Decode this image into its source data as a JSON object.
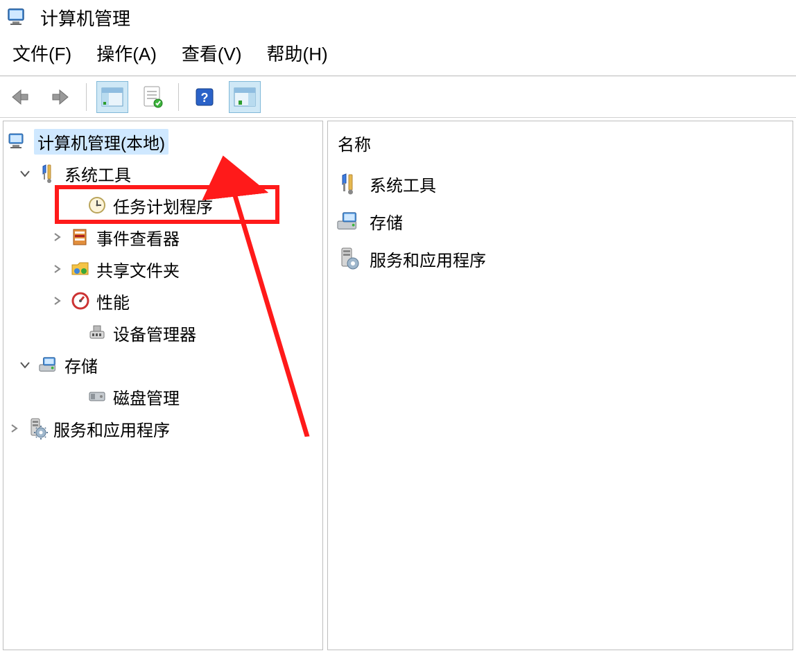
{
  "window": {
    "title": "计算机管理"
  },
  "menu": {
    "file": "文件(F)",
    "action": "操作(A)",
    "view": "查看(V)",
    "help": "帮助(H)"
  },
  "tree": {
    "root": "计算机管理(本地)",
    "system_tools": "系统工具",
    "task_scheduler": "任务计划程序",
    "event_viewer": "事件查看器",
    "shared_folders": "共享文件夹",
    "performance": "性能",
    "device_manager": "设备管理器",
    "storage": "存储",
    "disk_management": "磁盘管理",
    "services_apps": "服务和应用程序"
  },
  "right": {
    "column_name": "名称",
    "items": [
      "系统工具",
      "存储",
      "服务和应用程序"
    ]
  }
}
